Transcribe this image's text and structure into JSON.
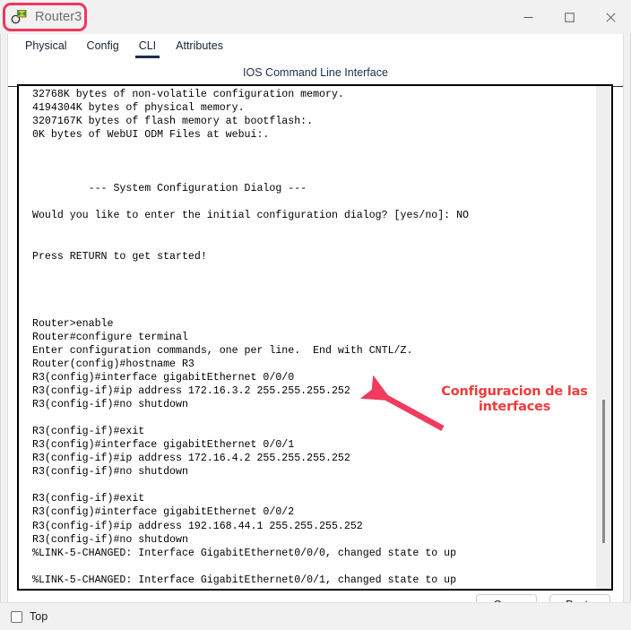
{
  "window": {
    "title": "Router3",
    "icon": "router-magnifier-icon",
    "controls": [
      {
        "name": "minimize",
        "glyph": "minimize-icon"
      },
      {
        "name": "maximize",
        "glyph": "maximize-icon"
      },
      {
        "name": "close",
        "glyph": "close-icon"
      }
    ]
  },
  "tabs": [
    {
      "label": "Physical",
      "active": false
    },
    {
      "label": "Config",
      "active": false
    },
    {
      "label": "CLI",
      "active": true
    },
    {
      "label": "Attributes",
      "active": false
    }
  ],
  "panel": {
    "header": "IOS Command Line Interface"
  },
  "terminal": {
    "content": "32768K bytes of non-volatile configuration memory.\n4194304K bytes of physical memory.\n3207167K bytes of flash memory at bootflash:.\n0K bytes of WebUI ODM Files at webui:.\n\n\n\n         --- System Configuration Dialog ---\n\nWould you like to enter the initial configuration dialog? [yes/no]: NO\n\n\nPress RETURN to get started!\n\n\n\n\nRouter>enable\nRouter#configure terminal\nEnter configuration commands, one per line.  End with CNTL/Z.\nRouter(config)#hostname R3\nR3(config)#interface gigabitEthernet 0/0/0\nR3(config-if)#ip address 172.16.3.2 255.255.255.252\nR3(config-if)#no shutdown\n\nR3(config-if)#exit\nR3(config)#interface gigabitEthernet 0/0/1\nR3(config-if)#ip address 172.16.4.2 255.255.255.252\nR3(config-if)#no shutdown\n\nR3(config-if)#exit\nR3(config)#interface gigabitEthernet 0/0/2\nR3(config-if)#ip address 192.168.44.1 255.255.255.252\nR3(config-if)#no shutdown\n%LINK-5-CHANGED: Interface GigabitEthernet0/0/0, changed state to up\n\n%LINK-5-CHANGED: Interface GigabitEthernet0/0/1, changed state to up"
  },
  "annotation": {
    "text": "Configuracion de las interfaces",
    "color": "#ef3b3b",
    "arrow": "red-arrow-icon",
    "title_highlight_color": "#f0365c"
  },
  "buttons": {
    "copy": "Copy",
    "paste": "Paste"
  },
  "statusbar": {
    "top_label": "Top",
    "top_checked": false
  }
}
